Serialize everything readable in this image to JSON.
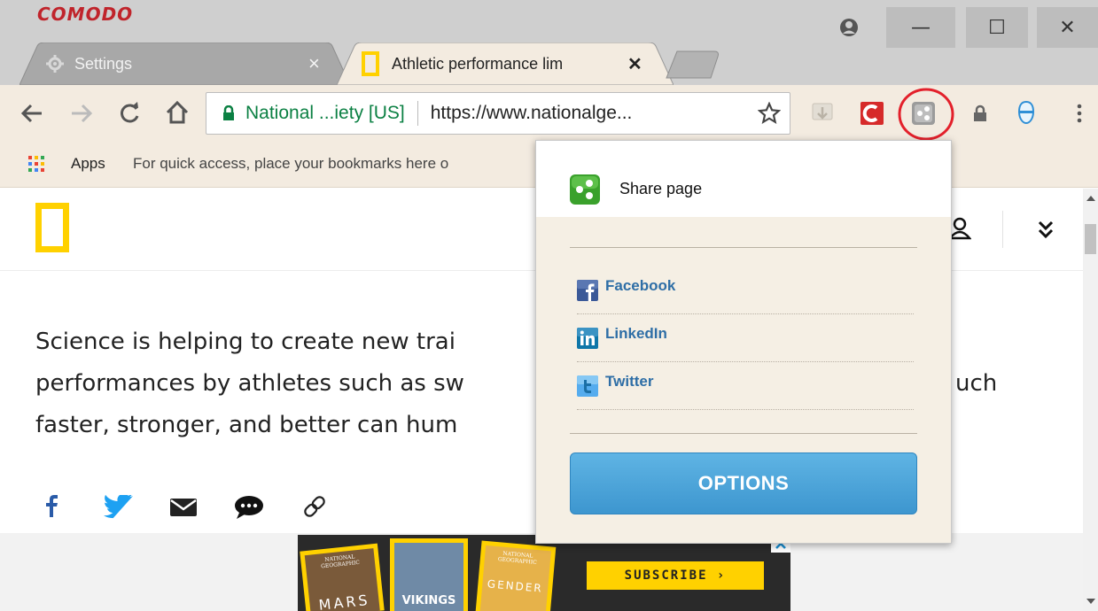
{
  "browser": {
    "brand": "COMODO",
    "tabs": [
      {
        "label": "Settings",
        "close": "×"
      },
      {
        "label": "Athletic performance lim",
        "close": "✕"
      }
    ],
    "window_controls": {
      "minimize": "—",
      "maximize": "☐",
      "close": "✕"
    }
  },
  "toolbar": {
    "site_identity": "National ...iety [US]",
    "url": "https://www.nationalge..."
  },
  "bookmarks": {
    "apps_label": "Apps",
    "hint": "For quick access, place your bookmarks here o"
  },
  "article": {
    "lines": [
      "Science is helping to create new trai",
      "performances by athletes such as sw",
      "faster, stronger, and better can hum"
    ],
    "line_suffix": "uch"
  },
  "ad": {
    "subscribe": "SUBSCRIBE ›",
    "cover_texts": [
      "NATIONAL GEOGRAPHIC",
      "MARS",
      "VIKINGS",
      "NATIONAL GEOGRAPHIC",
      "GENDER"
    ]
  },
  "share_popup": {
    "title": "Share page",
    "items": [
      {
        "label": "Facebook",
        "icon": "facebook-icon"
      },
      {
        "label": "LinkedIn",
        "icon": "linkedin-icon"
      },
      {
        "label": "Twitter",
        "icon": "twitter-icon"
      }
    ],
    "options_label": "OPTIONS"
  },
  "colors": {
    "highlight_circle": "#e3202b",
    "natgeo_yellow": "#ffd100",
    "link_blue": "#2e6ea6",
    "options_blue": "#4aa3d8"
  }
}
